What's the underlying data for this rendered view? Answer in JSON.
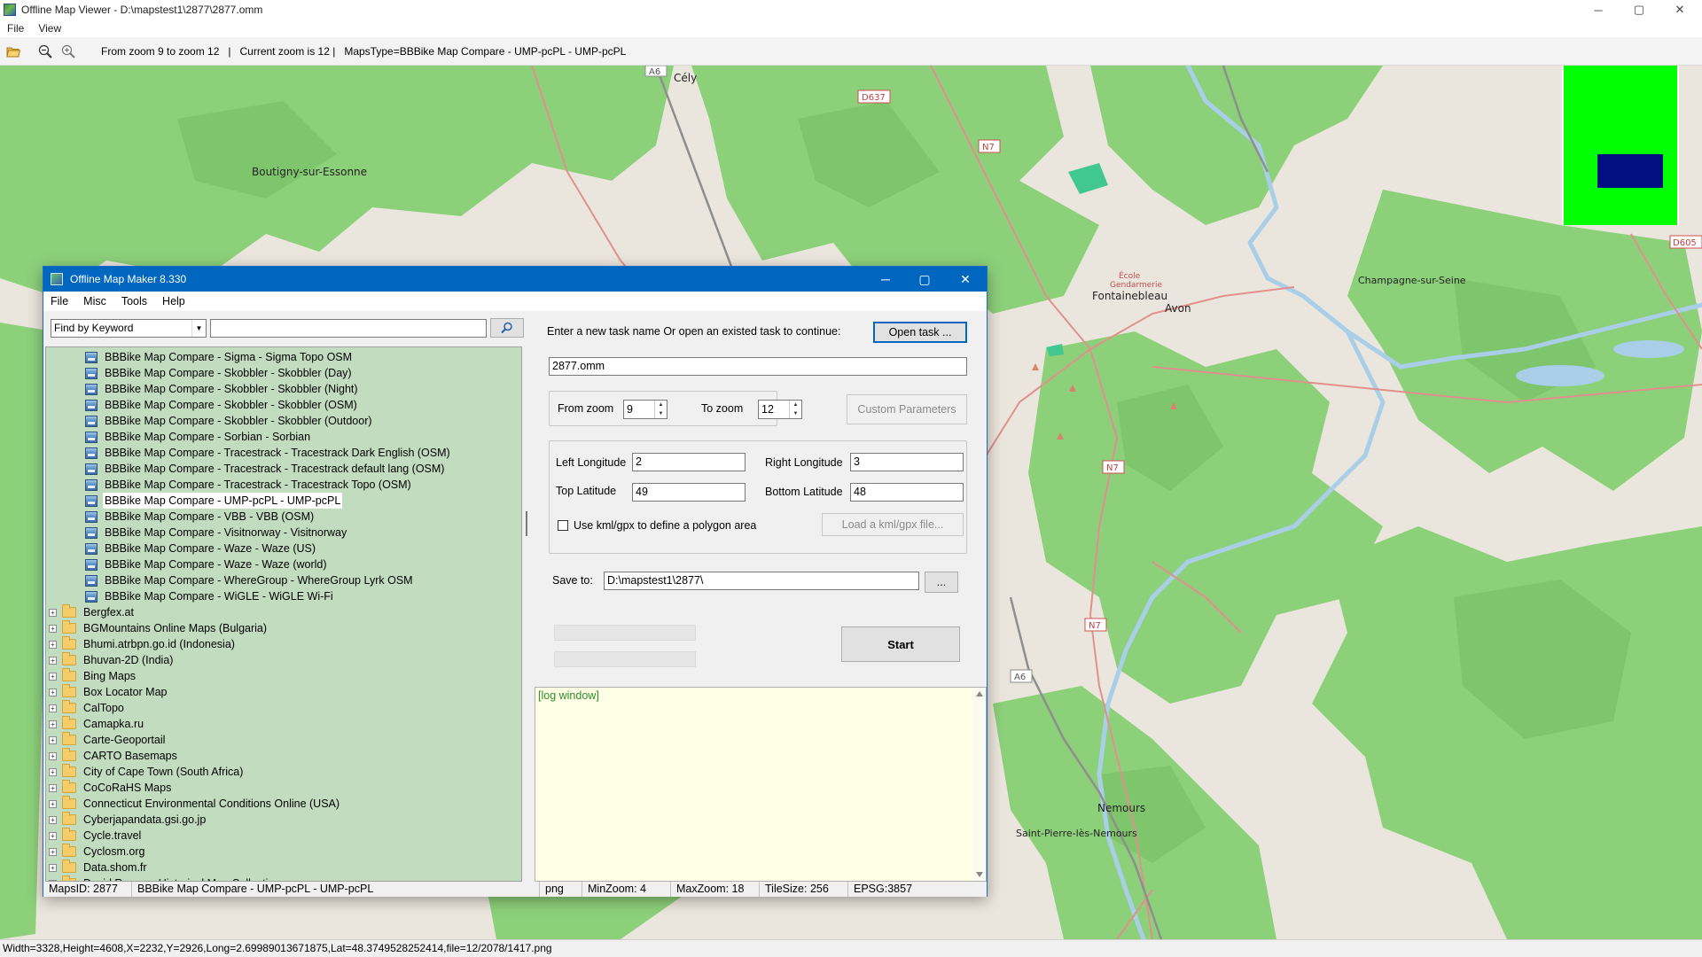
{
  "window": {
    "title": "Offline Map Viewer - D:\\mapstest1\\2877\\2877.omm",
    "controls": [
      "─",
      "▢",
      "✕"
    ]
  },
  "menu": [
    "File",
    "View"
  ],
  "toolbar": {
    "info": "From zoom 9 to zoom 12   |   Current zoom is 12 |   MapsType=BBBike Map Compare - UMP-pcPL - UMP-pcPL"
  },
  "map_labels": {
    "cely": "Cély",
    "boutigny": "Boutigny-sur-Essonne",
    "fontainebleau": "Fontainebleau",
    "avon": "Avon",
    "champagne": "Champagne-sur-Seine",
    "nemours": "Nemours",
    "saint_pierre": "Saint-Pierre-lès-Nemours",
    "gendarmerie": "Gendarmerie",
    "ecole": "École",
    "road_a6_top": "A6",
    "road_d637": "D637",
    "road_n7_top": "N7",
    "road_n7_mid": "N7",
    "road_n7_low": "N7",
    "road_a6_low": "A6",
    "road_d605": "D605"
  },
  "statusbar": {
    "text": "Width=3328,Height=4608,X=2232,Y=2926,Long=2.69989013671875,Lat=48.3749528252414,file=12/2078/1417.png"
  },
  "dialog": {
    "title": "Offline Map Maker 8.330",
    "controls": [
      "─",
      "▢",
      "✕"
    ],
    "menu": [
      "File",
      "Misc",
      "Tools",
      "Help"
    ],
    "find": {
      "combo_value": "Find by Keyword",
      "keyword_value": ""
    },
    "tree": {
      "children": [
        "BBBike Map Compare - Sigma - Sigma Topo OSM",
        "BBBike Map Compare - Skobbler - Skobbler (Day)",
        "BBBike Map Compare - Skobbler - Skobbler (Night)",
        "BBBike Map Compare - Skobbler - Skobbler (OSM)",
        "BBBike Map Compare - Skobbler - Skobbler (Outdoor)",
        "BBBike Map Compare - Sorbian - Sorbian",
        "BBBike Map Compare - Tracestrack - Tracestrack Dark English (OSM)",
        "BBBike Map Compare - Tracestrack - Tracestrack default lang (OSM)",
        "BBBike Map Compare - Tracestrack - Tracestrack Topo (OSM)",
        "BBBike Map Compare - UMP-pcPL - UMP-pcPL",
        "BBBike Map Compare - VBB - VBB (OSM)",
        "BBBike Map Compare - Visitnorway - Visitnorway",
        "BBBike Map Compare - Waze - Waze (US)",
        "BBBike Map Compare - Waze - Waze (world)",
        "BBBike Map Compare - WhereGroup - WhereGroup Lyrk OSM",
        "BBBike Map Compare - WiGLE - WiGLE Wi-Fi"
      ],
      "selected_index": 9,
      "folders": [
        "Bergfex.at",
        "BGMountains Online Maps (Bulgaria)",
        "Bhumi.atrbpn.go.id (Indonesia)",
        "Bhuvan-2D (India)",
        "Bing Maps",
        "Box Locator Map",
        "CalTopo",
        "Camapka.ru",
        "Carte-Geoportail",
        "CARTO Basemaps",
        "City of Cape Town (South Africa)",
        "CoCoRaHS Maps",
        "Connecticut Environmental Conditions Online (USA)",
        "Cyberjapandata.gsi.go.jp",
        "Cycle.travel",
        "Cyclosm.org",
        "Data.shom.fr",
        "David Rumsey Historical Map Collection"
      ]
    },
    "task": {
      "prompt": "Enter a new task name Or open an existed task to continue:",
      "open_button": "Open task ...",
      "task_name": "2877.omm"
    },
    "zoom": {
      "from_label": "From zoom",
      "from_value": "9",
      "to_label": "To zoom",
      "to_value": "12",
      "custom_button": "Custom Parameters"
    },
    "area": {
      "left_lon_label": "Left Longitude",
      "left_lon": "2",
      "right_lon_label": "Right Longitude",
      "right_lon": "3",
      "top_lat_label": "Top Latitude",
      "top_lat": "49",
      "bottom_lat_label": "Bottom Latitude",
      "bottom_lat": "48",
      "kml_label": "Use kml/gpx to define a polygon area",
      "kml_checked": false,
      "load_button": "Load a kml/gpx file..."
    },
    "save": {
      "label": "Save to:",
      "path": "D:\\mapstest1\\2877\\",
      "browse_button": "..."
    },
    "start_button": "Start",
    "log_text": "[log window]",
    "status": {
      "maps_id": "MapsID: 2877",
      "name": "BBBike Map Compare - UMP-pcPL - UMP-pcPL",
      "format": "png",
      "min_zoom": "MinZoom: 4",
      "max_zoom": "MaxZoom: 18",
      "tile_size": "TileSize: 256",
      "epsg": "EPSG:3857"
    }
  },
  "colors": {
    "forest": "#8cd07a",
    "forest_dark": "#7cc36a",
    "land": "#ebe6dd",
    "water": "#a9cfe8",
    "road_red": "#e1908e",
    "road_gray": "#8e8e8e",
    "tree_bg": "#c2dcc0",
    "log_bg": "#ffffe6",
    "title_blue": "#0067c0",
    "minimap_green": "#00ff00",
    "minimap_blue": "#001080"
  }
}
